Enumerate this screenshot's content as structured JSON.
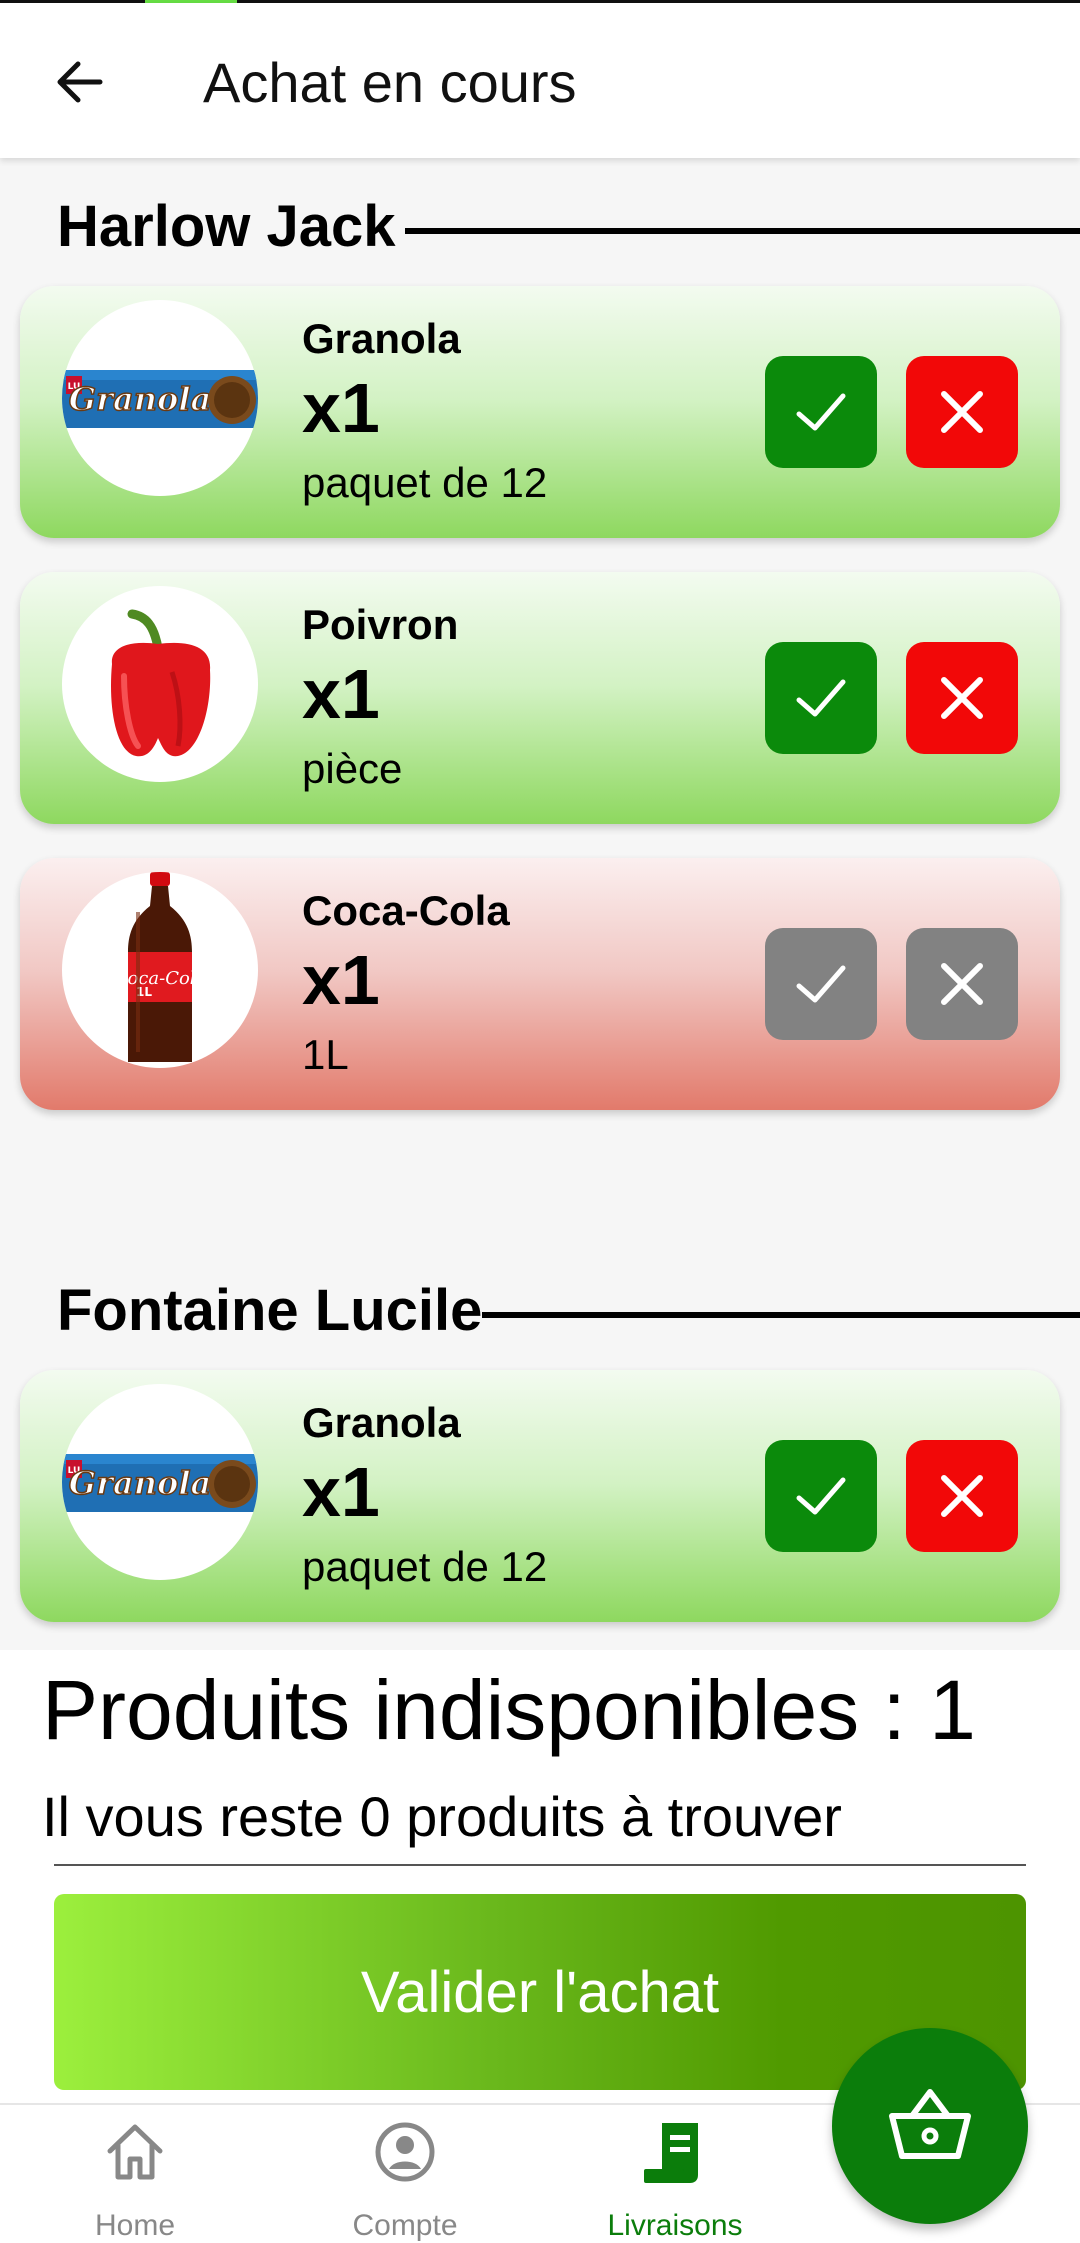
{
  "appbar": {
    "title": "Achat en cours"
  },
  "groups": [
    {
      "customer": "Harlow Jack",
      "items": [
        {
          "name": "Granola",
          "qty": "x1",
          "unit": "paquet de 12",
          "status": "available",
          "image": "granola"
        },
        {
          "name": "Poivron",
          "qty": "x1",
          "unit": "pièce",
          "status": "available",
          "image": "pepper"
        },
        {
          "name": "Coca-Cola",
          "qty": "x1",
          "unit": "1L",
          "status": "unavailable",
          "image": "coca"
        }
      ]
    },
    {
      "customer": "Fontaine Lucile",
      "items": [
        {
          "name": "Granola",
          "qty": "x1",
          "unit": "paquet de 12",
          "status": "available",
          "image": "granola"
        }
      ]
    }
  ],
  "summary": {
    "unavailable": "Produits indisponibles : 1",
    "remaining": "Il vous reste 0 produits à trouver",
    "validate_label": "Valider l'achat"
  },
  "nav": {
    "items": [
      {
        "label": "Home",
        "icon": "home-icon",
        "active": false
      },
      {
        "label": "Compte",
        "icon": "account-icon",
        "active": false
      },
      {
        "label": "Livraisons",
        "icon": "delivery-icon",
        "active": true
      }
    ],
    "fab_icon": "basket-icon"
  },
  "colors": {
    "accept": "#0b8a0b",
    "reject": "#f20808",
    "disabled": "#828282",
    "brand_green": "#0b7d0b"
  }
}
